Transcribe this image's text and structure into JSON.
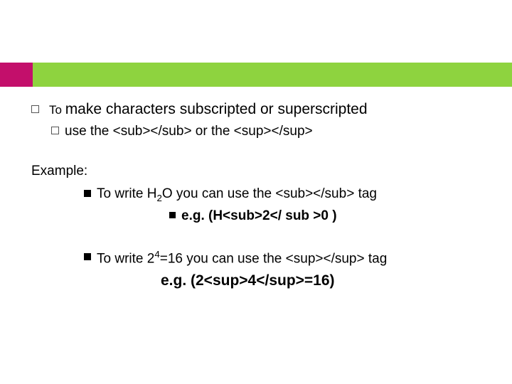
{
  "header": {
    "accent_color": "#c30f6b",
    "band_color": "#8ed33f"
  },
  "main_bullet": {
    "line1_to": "To ",
    "line1_rest": "make characters subscripted or superscripted",
    "line2": "use the <sub></sub> or the <sup></sup>"
  },
  "example_label": "Example:",
  "items": [
    {
      "prefix": "To write H",
      "mid_small": "2",
      "suffix": "O  you can use the <sub></sub> tag",
      "eg": "e.g. (H<sub>2</ sub >0 )",
      "show_eg_bullet": true
    },
    {
      "prefix": "To write 2",
      "mid_small": "4",
      "suffix": "=16 you can use the <sup></sup> tag",
      "eg": "e.g. (2<sup>4</sup>=16)",
      "show_eg_bullet": false
    }
  ]
}
